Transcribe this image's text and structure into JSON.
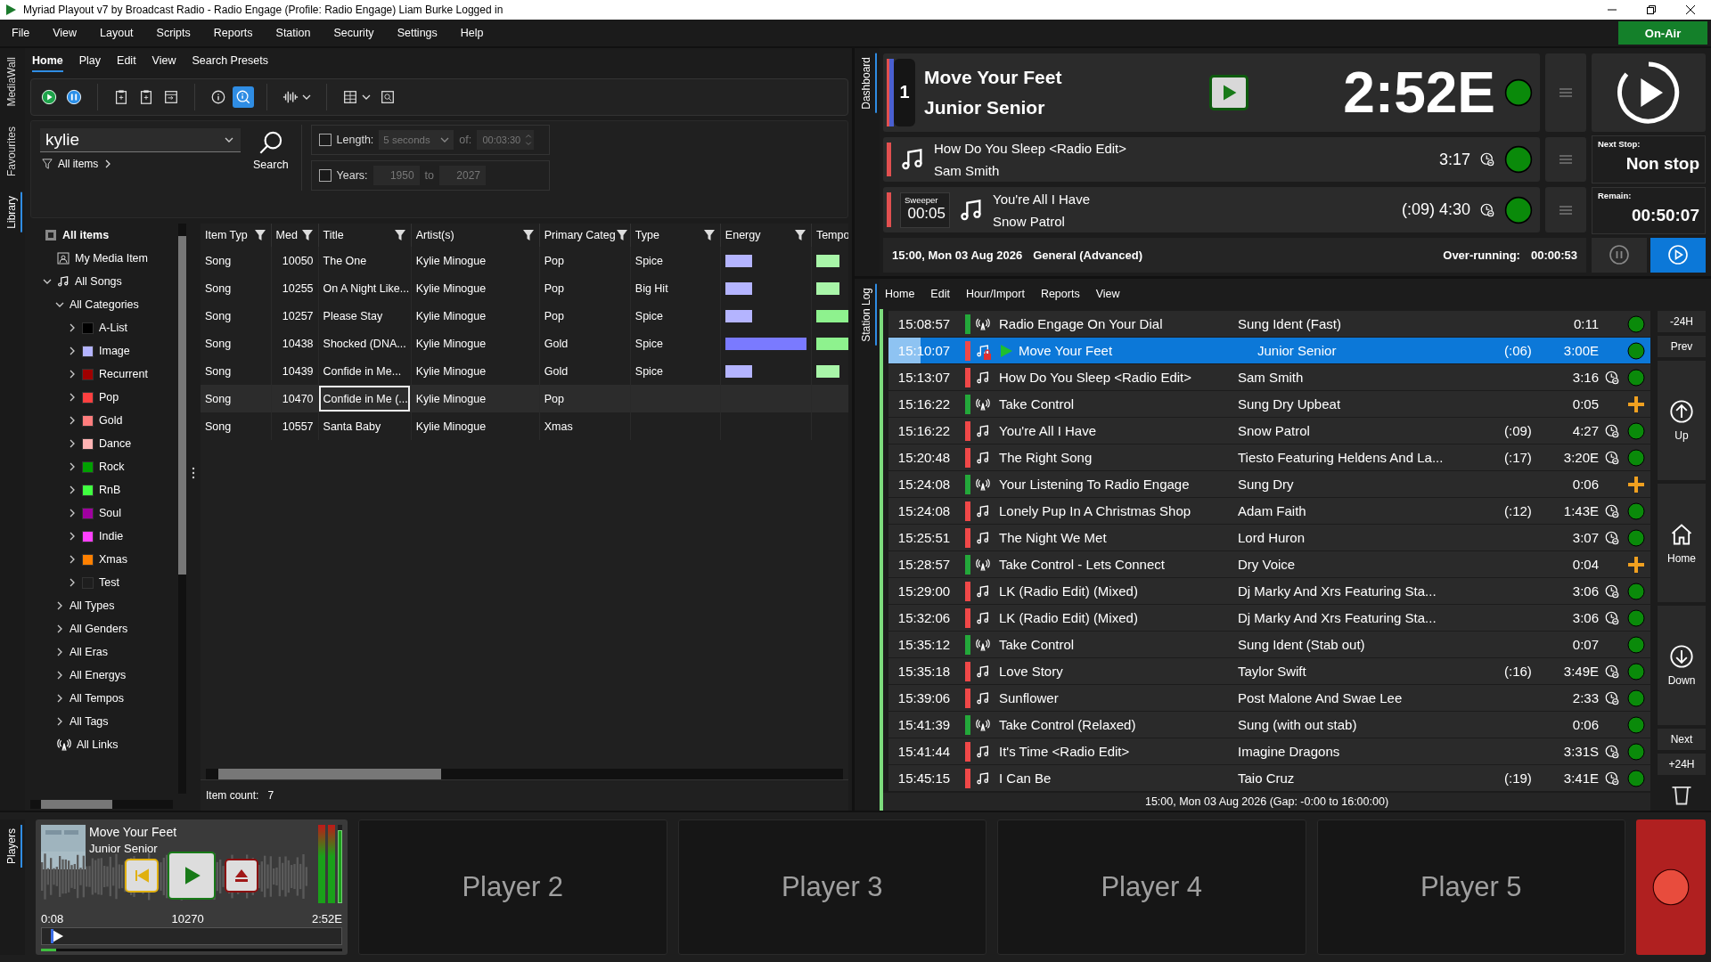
{
  "window": {
    "title": "Myriad Playout v7 by Broadcast Radio - Radio Engage (Profile: Radio Engage) Liam Burke Logged in"
  },
  "menu": [
    "File",
    "View",
    "Layout",
    "Scripts",
    "Reports",
    "Station",
    "Security",
    "Settings",
    "Help"
  ],
  "on_air": "On-Air",
  "library": {
    "side_tabs": [
      {
        "label": "MediaWall",
        "selected": false
      },
      {
        "label": "Favourites",
        "selected": false
      },
      {
        "label": "Library",
        "selected": true
      }
    ],
    "tabs": [
      {
        "label": "Home",
        "selected": true
      },
      {
        "label": "Play",
        "selected": false
      },
      {
        "label": "Edit",
        "selected": false
      },
      {
        "label": "View",
        "selected": false
      },
      {
        "label": "Search Presets",
        "selected": false
      }
    ],
    "toolbar": [
      {
        "kind": "play",
        "selected": false
      },
      {
        "kind": "pause",
        "selected": false
      },
      {
        "kind": "clipboard",
        "selected": false
      },
      {
        "kind": "clipboard",
        "selected": false
      },
      {
        "kind": "import",
        "selected": false
      },
      {
        "kind": "info",
        "selected": false
      },
      {
        "kind": "info-search",
        "selected": true
      },
      {
        "kind": "waveform",
        "selected": false
      },
      {
        "kind": "columns",
        "selected": false
      },
      {
        "kind": "zoom",
        "selected": false
      }
    ],
    "search": {
      "value": "kylie"
    },
    "filter": "All items",
    "search_button": "Search",
    "length": {
      "checked": false,
      "label": "Length:",
      "value": "5 seconds",
      "of_label": "of:",
      "of_value": "00:03:30"
    },
    "years": {
      "checked": false,
      "label": "Years:",
      "from": "1950",
      "to_label": "to",
      "to": "2027"
    },
    "tree": {
      "label": "All items",
      "kind": "root",
      "children": [
        {
          "label": "My Media Item",
          "kind": "media"
        },
        {
          "label": "All Songs",
          "kind": "songs",
          "expanded": true,
          "children": [
            {
              "label": "All Categories",
              "expanded": true,
              "children": [
                {
                  "label": "A-List",
                  "color": "#000000",
                  "expanded": false
                },
                {
                  "label": "Image",
                  "color": "#b4b4ff",
                  "expanded": false
                },
                {
                  "label": "Recurrent",
                  "color": "#a00000",
                  "expanded": false
                },
                {
                  "label": "Pop",
                  "color": "#ff4040",
                  "expanded": false
                },
                {
                  "label": "Gold",
                  "color": "#ff7d7d",
                  "expanded": false
                },
                {
                  "label": "Dance",
                  "color": "#ffb4b4",
                  "expanded": false
                },
                {
                  "label": "Rock",
                  "color": "#00a000",
                  "expanded": false
                },
                {
                  "label": "RnB",
                  "color": "#40ff40",
                  "expanded": false
                },
                {
                  "label": "Soul",
                  "color": "#a000a0",
                  "expanded": false
                },
                {
                  "label": "Indie",
                  "color": "#ff40ff",
                  "expanded": false
                },
                {
                  "label": "Xmas",
                  "color": "#ff8000",
                  "expanded": false
                },
                {
                  "label": "Test",
                  "color": "#1e1e1e",
                  "expanded": false
                }
              ]
            },
            {
              "label": "All Types",
              "expanded": false
            },
            {
              "label": "All Genders",
              "expanded": false
            },
            {
              "label": "All Eras",
              "expanded": false
            },
            {
              "label": "All Energys",
              "expanded": false
            },
            {
              "label": "All Tempos",
              "expanded": false
            },
            {
              "label": "All Tags",
              "expanded": false
            }
          ]
        },
        {
          "label": "All Links",
          "kind": "links"
        }
      ]
    },
    "table": {
      "columns": [
        {
          "label": "Item Typ",
          "filter": true
        },
        {
          "label": "Med",
          "filter": true
        },
        {
          "label": "Title",
          "filter": true
        },
        {
          "label": "Artist(s)",
          "filter": true
        },
        {
          "label": "Primary Categ",
          "filter": true
        },
        {
          "label": "Type",
          "filter": true
        },
        {
          "label": "Energy",
          "filter": true
        },
        {
          "label": "Tempo",
          "filter": false
        }
      ],
      "rows": [
        {
          "item_type": "Song",
          "med": "10050",
          "title": "The One",
          "artist": "Kylie Minogue",
          "category": "Pop",
          "type": "Spice",
          "energy": {
            "level": 0.33
          },
          "tempo": {
            "level": 0.5
          },
          "selected": false
        },
        {
          "item_type": "Song",
          "med": "10255",
          "title": "On A Night Like...",
          "artist": "Kylie Minogue",
          "category": "Pop",
          "type": "Big Hit",
          "energy": {
            "level": 0.33
          },
          "tempo": {
            "level": 0.5
          },
          "selected": false
        },
        {
          "item_type": "Song",
          "med": "10257",
          "title": "Please Stay",
          "artist": "Kylie Minogue",
          "category": "Pop",
          "type": "Spice",
          "energy": {
            "level": 0.33
          },
          "tempo": {
            "level": 1
          },
          "selected": false
        },
        {
          "item_type": "Song",
          "med": "10438",
          "title": "Shocked (DNA...",
          "artist": "Kylie Minogue",
          "category": "Gold",
          "type": "Spice",
          "energy": {
            "level": 1
          },
          "tempo": {
            "level": 1
          },
          "selected": false
        },
        {
          "item_type": "Song",
          "med": "10439",
          "title": "Confide in Me...",
          "artist": "Kylie Minogue",
          "category": "Gold",
          "type": "Spice",
          "energy": {
            "level": 0.33
          },
          "tempo": {
            "level": 0.5
          },
          "selected": false
        },
        {
          "item_type": "Song",
          "med": "10470",
          "title": "Confide in Me (...",
          "artist": "Kylie Minogue",
          "category": "Pop",
          "selected": true
        },
        {
          "item_type": "Song",
          "med": "10557",
          "title": "Santa Baby",
          "artist": "Kylie Minogue",
          "category": "Xmas",
          "selected": false
        }
      ]
    },
    "item_count": {
      "label": "Item count:",
      "value": "7"
    }
  },
  "dashboard": {
    "side_tab": {
      "label": "Dashboard",
      "selected": true
    },
    "current": {
      "number": "1",
      "title": "Move Your Feet",
      "artist": "Junior Senior",
      "time": "2:52E",
      "status": {
        "kind": "dot"
      }
    },
    "next": [
      {
        "title": "How Do You Sleep <Radio Edit>",
        "artist": "Sam Smith",
        "time": "3:17",
        "status": {
          "kind": "dot"
        }
      },
      {
        "sweeper_label": "Sweeper",
        "sweeper_time": "00:05",
        "title": "You're All I Have",
        "artist": "Snow Patrol",
        "time": "(:09) 4:30",
        "status": {
          "kind": "dot"
        }
      }
    ],
    "next_stop": {
      "label": "Next Stop:",
      "value": "Non stop"
    },
    "remain": {
      "label": "Remain:",
      "value": "00:50:07"
    },
    "footer": {
      "date": "15:00, Mon 03 Aug 2026",
      "format": "General (Advanced)",
      "over_label": "Over-running:",
      "over_value": "00:00:53"
    },
    "transport": [
      {
        "kind": "pause",
        "selected": false
      },
      {
        "kind": "play",
        "selected": true
      }
    ]
  },
  "station_log": {
    "side_tab": {
      "label": "Station Log",
      "selected": true
    },
    "tabs": [
      "Home",
      "Edit",
      "Hour/Import",
      "Reports",
      "View"
    ],
    "rows": [
      {
        "time": "15:08:57",
        "kind": "link",
        "title": "Radio Engage On Your Dial",
        "artist": "Sung Ident (Fast)",
        "duration": "0:11",
        "status": {
          "kind": "dot"
        },
        "selected": false,
        "playing": false
      },
      {
        "time": "15:10:07",
        "kind": "song",
        "title": "Move Your Feet",
        "artist": "Junior Senior",
        "intro": "(:06)",
        "duration": "3:00E",
        "status": {
          "kind": "dot"
        },
        "selected": true,
        "playing": true,
        "level": 0.45
      },
      {
        "time": "15:13:07",
        "kind": "song",
        "title": "How Do You Sleep <Radio Edit>",
        "artist": "Sam Smith",
        "duration": "3:16",
        "status": {
          "kind": "dot"
        },
        "selected": false,
        "playing": false
      },
      {
        "time": "15:16:22",
        "kind": "link",
        "title": "Take Control",
        "artist": "Sung Dry Upbeat",
        "duration": "0:05",
        "status": {
          "kind": "plus"
        },
        "selected": false,
        "playing": false
      },
      {
        "time": "15:16:22",
        "kind": "song",
        "title": "You're All I Have",
        "artist": "Snow Patrol",
        "intro": "(:09)",
        "duration": "4:27",
        "status": {
          "kind": "dot"
        },
        "selected": false,
        "playing": false
      },
      {
        "time": "15:20:48",
        "kind": "song",
        "title": "The Right Song",
        "artist": "Tiesto Featuring Heldens And La...",
        "intro": "(:17)",
        "duration": "3:20E",
        "status": {
          "kind": "dot"
        },
        "selected": false,
        "playing": false
      },
      {
        "time": "15:24:08",
        "kind": "link",
        "title": "Your Listening To Radio Engage",
        "artist": "Sung Dry",
        "duration": "0:06",
        "status": {
          "kind": "plus"
        },
        "selected": false,
        "playing": false
      },
      {
        "time": "15:24:08",
        "kind": "song",
        "title": "Lonely Pup In A Christmas Shop",
        "artist": "Adam Faith",
        "intro": "(:12)",
        "duration": "1:43E",
        "status": {
          "kind": "dot"
        },
        "selected": false,
        "playing": false
      },
      {
        "time": "15:25:51",
        "kind": "song",
        "title": "The Night We Met",
        "artist": "Lord Huron",
        "duration": "3:07",
        "status": {
          "kind": "dot"
        },
        "selected": false,
        "playing": false
      },
      {
        "time": "15:28:57",
        "kind": "link",
        "title": "Take Control - Lets Connect",
        "artist": "Dry Voice",
        "duration": "0:04",
        "status": {
          "kind": "plus"
        },
        "selected": false,
        "playing": false
      },
      {
        "time": "15:29:00",
        "kind": "song",
        "title": "LK (Radio Edit) (Mixed)",
        "artist": "Dj Marky And Xrs Featuring Sta...",
        "duration": "3:06",
        "status": {
          "kind": "dot"
        },
        "selected": false,
        "playing": false
      },
      {
        "time": "15:32:06",
        "kind": "song",
        "title": "LK (Radio Edit) (Mixed)",
        "artist": "Dj Marky And Xrs Featuring Sta...",
        "duration": "3:06",
        "status": {
          "kind": "dot"
        },
        "selected": false,
        "playing": false
      },
      {
        "time": "15:35:12",
        "kind": "link",
        "title": "Take Control",
        "artist": "Sung Ident (Stab out)",
        "duration": "0:07",
        "status": {
          "kind": "dot"
        },
        "selected": false,
        "playing": false
      },
      {
        "time": "15:35:18",
        "kind": "song",
        "title": "Love Story",
        "artist": "Taylor Swift",
        "intro": "(:16)",
        "duration": "3:49E",
        "status": {
          "kind": "dot"
        },
        "selected": false,
        "playing": false
      },
      {
        "time": "15:39:06",
        "kind": "song",
        "title": "Sunflower",
        "artist": "Post Malone And Swae Lee",
        "duration": "2:33",
        "status": {
          "kind": "dot"
        },
        "selected": false,
        "playing": false
      },
      {
        "time": "15:41:39",
        "kind": "link",
        "title": "Take Control (Relaxed)",
        "artist": "Sung (with out stab)",
        "duration": "0:06",
        "status": {
          "kind": "dot"
        },
        "selected": false,
        "playing": false
      },
      {
        "time": "15:41:44",
        "kind": "song",
        "title": "It's Time <Radio Edit>",
        "artist": "Imagine Dragons",
        "duration": "3:31S",
        "status": {
          "kind": "dot"
        },
        "selected": false,
        "playing": false
      },
      {
        "time": "15:45:15",
        "kind": "song",
        "title": "I Can Be",
        "artist": "Taio Cruz",
        "intro": "(:19)",
        "duration": "3:41E",
        "status": {
          "kind": "dot"
        },
        "selected": false,
        "playing": false
      }
    ],
    "nav": [
      {
        "kind": "text",
        "label": "-24H"
      },
      {
        "kind": "text",
        "label": "Prev"
      },
      {
        "kind": "up",
        "label": "Up"
      },
      {
        "kind": "home",
        "label": "Home"
      },
      {
        "kind": "down",
        "label": "Down"
      },
      {
        "kind": "text",
        "label": "Next"
      },
      {
        "kind": "text",
        "label": "+24H"
      },
      {
        "kind": "delete"
      }
    ],
    "footer": "15:00, Mon 03 Aug 2026 (Gap: -0:00 to 16:00:00)"
  },
  "players": {
    "side_tab": {
      "label": "Players",
      "selected": true
    },
    "player": {
      "title": "Move Your Feet",
      "artist": "Junior Senior",
      "elapsed": "0:08",
      "id": "10270",
      "remaining": "2:52E",
      "progress": {
        "level": 0.03
      },
      "gain": {
        "level": 0.05
      },
      "meters": [
        {
          "level": 1
        },
        {
          "level": 1
        },
        {
          "level": 0.93
        }
      ]
    },
    "empty": [
      "Player 2",
      "Player 3",
      "Player 4",
      "Player 5"
    ]
  }
}
